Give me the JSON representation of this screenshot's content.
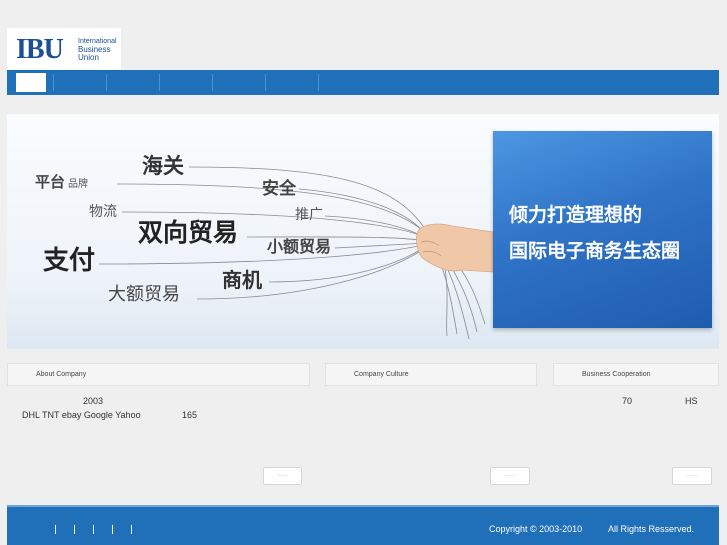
{
  "header": {
    "logo": {
      "mark": "IBU",
      "line1": "International",
      "line2": "Business",
      "line3": "Union"
    },
    "nav": {
      "items": [
        {
          "label": ""
        },
        {
          "label": ""
        },
        {
          "label": ""
        },
        {
          "label": ""
        },
        {
          "label": ""
        },
        {
          "label": ""
        }
      ]
    }
  },
  "banner": {
    "words": {
      "haiguan": "海关",
      "pingtai": "平台",
      "pinpai": "品牌",
      "anquan": "安全",
      "wuliu": "物流",
      "tuiguang": "推广",
      "shuangxiang": "双向贸易",
      "xiaoe": "小额贸易",
      "zhifu": "支付",
      "shangji": "商机",
      "dae": "大额贸易"
    },
    "card": {
      "line1": "倾力打造理想的",
      "line2": "国际电子商务生态圈"
    }
  },
  "sections": {
    "about": {
      "title": "About Company",
      "line1": "2003",
      "line2": "DHL TNT ebay Google Yahoo",
      "line2b": "165",
      "more": "······"
    },
    "culture": {
      "title": "Company Culture",
      "more": "······"
    },
    "cooperation": {
      "title": "Business Cooperation",
      "num": "70",
      "code": "HS",
      "more": "······"
    }
  },
  "footer": {
    "links": [
      "",
      "",
      "",
      "",
      ""
    ],
    "copyright": "Copyright © 2003-2010",
    "rights": "All Rights Resserved."
  },
  "colors": {
    "brand_blue": "#1f6fb9",
    "logo_blue": "#1a4f98",
    "card_blue": "#2f73c7"
  }
}
